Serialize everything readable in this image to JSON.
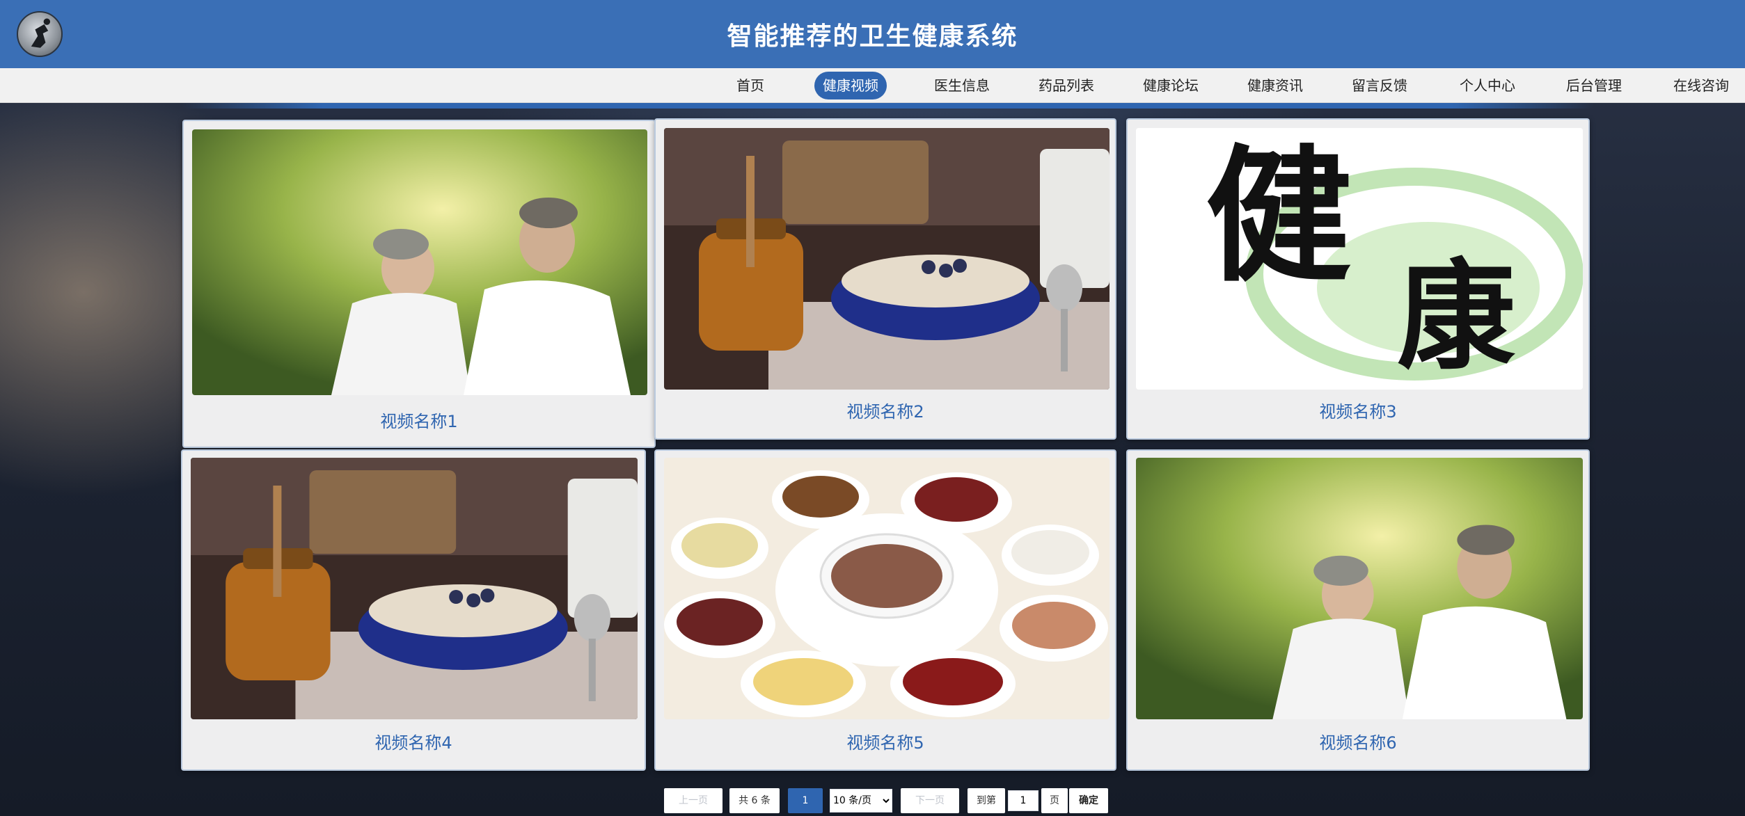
{
  "header": {
    "title": "智能推荐的卫生健康系统"
  },
  "nav": {
    "items": [
      {
        "label": "首页"
      },
      {
        "label": "健康视频"
      },
      {
        "label": "医生信息"
      },
      {
        "label": "药品列表"
      },
      {
        "label": "健康论坛"
      },
      {
        "label": "健康资讯"
      },
      {
        "label": "留言反馈"
      },
      {
        "label": "个人中心"
      },
      {
        "label": "后台管理"
      },
      {
        "label": "在线咨询"
      }
    ],
    "active_index": 1
  },
  "videos": [
    {
      "name": "视频名称1",
      "image": "elderly-couple"
    },
    {
      "name": "视频名称2",
      "image": "oatmeal-honey"
    },
    {
      "name": "视频名称3",
      "image": "calligraphy-jiankang"
    },
    {
      "name": "视频名称4",
      "image": "oatmeal-honey"
    },
    {
      "name": "视频名称5",
      "image": "grains-porridge"
    },
    {
      "name": "视频名称6",
      "image": "elderly-couple"
    }
  ],
  "pagination": {
    "prev_label": "上一页",
    "total_label": "共 6 条",
    "current_page": "1",
    "page_size_label": "10 条/页",
    "next_label": "下一页",
    "goto_prefix": "到第",
    "goto_value": "1",
    "goto_suffix": "页",
    "confirm_label": "确定"
  },
  "calligraphy": {
    "chars": "健康"
  },
  "colors": {
    "brand": "#3a6fb6",
    "active": "#2f65b0",
    "caption": "#2f65b0"
  }
}
